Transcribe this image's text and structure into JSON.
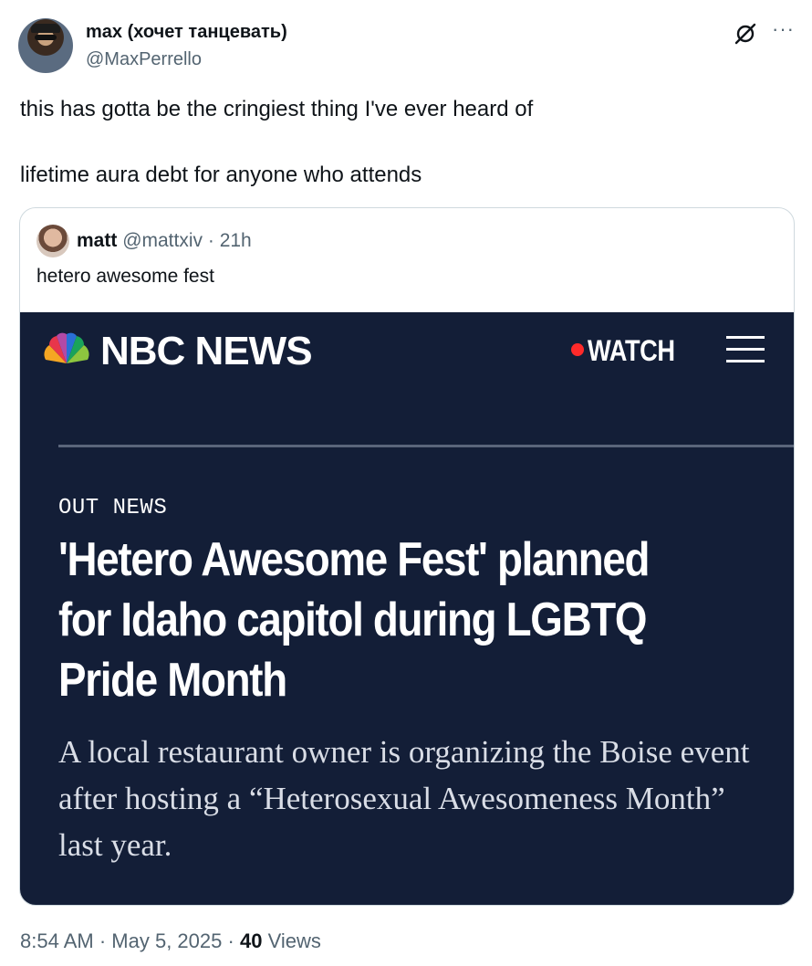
{
  "post": {
    "author_name": "max (хочет танцевать)",
    "author_handle": "@MaxPerrello",
    "text_lines": [
      "this has gotta be the cringiest thing I've ever heard of",
      "lifetime aura debt for anyone who attends"
    ],
    "time": "8:54 AM",
    "date": "May 5, 2025",
    "views_count": "40",
    "views_label": "Views",
    "separator": "·",
    "icons": [
      "grok-icon",
      "more-icon"
    ]
  },
  "quote": {
    "author_name": "matt",
    "author_handle": "@mattxiv",
    "separator": "·",
    "time": "21h",
    "text": "hetero awesome fest",
    "image": {
      "brand": "NBC NEWS",
      "watch_label": "WATCH",
      "section": "OUT NEWS",
      "headline_lines": [
        "'Hetero Awesome Fest' planned",
        "for Idaho capitol during LGBTQ",
        "Pride Month"
      ],
      "dek_lines": [
        "A local restaurant owner is organizing the Boise event",
        "after hosting a “Heterosexual Awesomeness Month”",
        "last year."
      ],
      "colors": {
        "background": "#131e37",
        "live_dot": "#ff2a2a"
      }
    }
  }
}
